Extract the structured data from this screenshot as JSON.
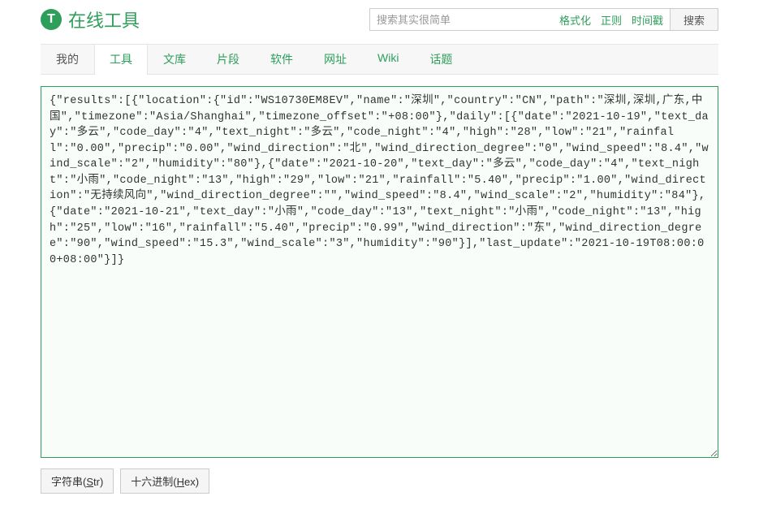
{
  "header": {
    "title": "在线工具",
    "search": {
      "placeholder": "搜索其实很简单",
      "links": {
        "format": "格式化",
        "regex": "正则",
        "timestamp": "时间戳"
      },
      "button": "搜索"
    }
  },
  "nav": {
    "items": [
      {
        "label": "我的",
        "active": false,
        "first": true
      },
      {
        "label": "工具",
        "active": true
      },
      {
        "label": "文库",
        "active": false
      },
      {
        "label": "片段",
        "active": false
      },
      {
        "label": "软件",
        "active": false
      },
      {
        "label": "网址",
        "active": false
      },
      {
        "label": "Wiki",
        "active": false
      },
      {
        "label": "话题",
        "active": false
      }
    ]
  },
  "textarea": {
    "content": "{\"results\":[{\"location\":{\"id\":\"WS10730EM8EV\",\"name\":\"深圳\",\"country\":\"CN\",\"path\":\"深圳,深圳,广东,中国\",\"timezone\":\"Asia/Shanghai\",\"timezone_offset\":\"+08:00\"},\"daily\":[{\"date\":\"2021-10-19\",\"text_day\":\"多云\",\"code_day\":\"4\",\"text_night\":\"多云\",\"code_night\":\"4\",\"high\":\"28\",\"low\":\"21\",\"rainfall\":\"0.00\",\"precip\":\"0.00\",\"wind_direction\":\"北\",\"wind_direction_degree\":\"0\",\"wind_speed\":\"8.4\",\"wind_scale\":\"2\",\"humidity\":\"80\"},{\"date\":\"2021-10-20\",\"text_day\":\"多云\",\"code_day\":\"4\",\"text_night\":\"小雨\",\"code_night\":\"13\",\"high\":\"29\",\"low\":\"21\",\"rainfall\":\"5.40\",\"precip\":\"1.00\",\"wind_direction\":\"无持续风向\",\"wind_direction_degree\":\"\",\"wind_speed\":\"8.4\",\"wind_scale\":\"2\",\"humidity\":\"84\"},{\"date\":\"2021-10-21\",\"text_day\":\"小雨\",\"code_day\":\"13\",\"text_night\":\"小雨\",\"code_night\":\"13\",\"high\":\"25\",\"low\":\"16\",\"rainfall\":\"5.40\",\"precip\":\"0.99\",\"wind_direction\":\"东\",\"wind_direction_degree\":\"90\",\"wind_speed\":\"15.3\",\"wind_scale\":\"3\",\"humidity\":\"90\"}],\"last_update\":\"2021-10-19T08:00:00+08:00\"}]}"
  },
  "buttons": {
    "string": {
      "text": "字符串(",
      "key": "S",
      "suffix": "tr)"
    },
    "hex": {
      "text": "十六进制(",
      "key": "H",
      "suffix": "ex)"
    }
  }
}
